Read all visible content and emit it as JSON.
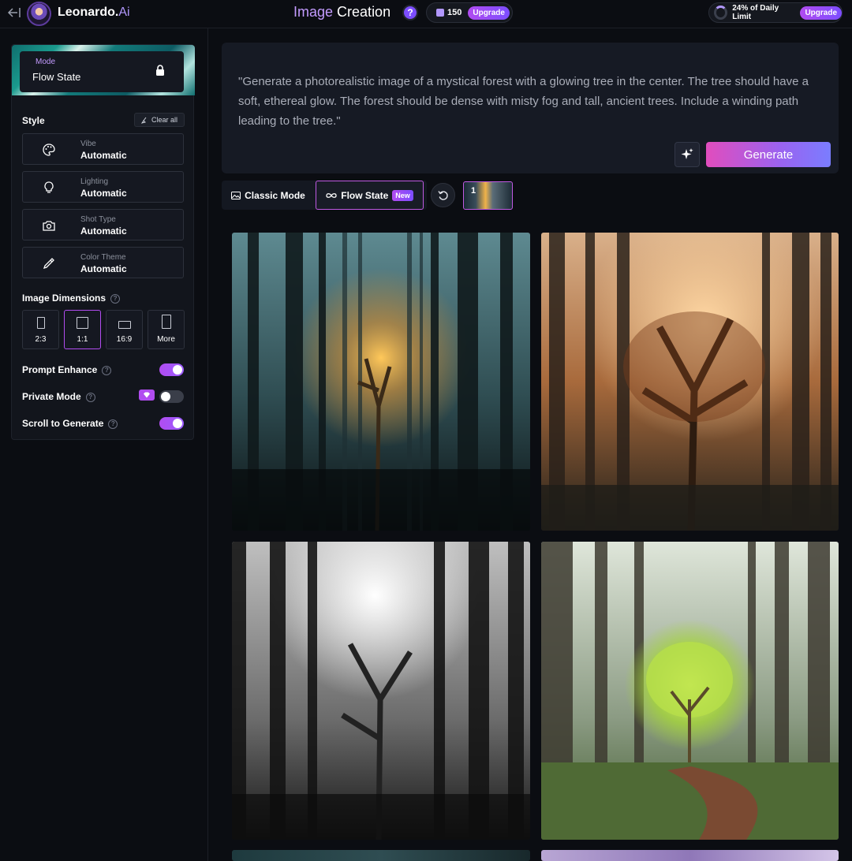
{
  "header": {
    "brand_name": "Leonardo.",
    "brand_suffix": "Ai",
    "title_word1": "Image",
    "title_word2": "Creation",
    "help": "?",
    "tokens": "150",
    "upgrade_label": "Upgrade",
    "daily_limit_text": "24% of Daily Limit",
    "daily_limit_fraction": 0.24,
    "limit_upgrade_label": "Upgrade"
  },
  "sidebar": {
    "mode_label": "Mode",
    "mode_value": "Flow State",
    "style_heading": "Style",
    "clear_all": "Clear all",
    "style_options": [
      {
        "label": "Vibe",
        "value": "Automatic",
        "icon": "palette-icon"
      },
      {
        "label": "Lighting",
        "value": "Automatic",
        "icon": "lightbulb-icon"
      },
      {
        "label": "Shot Type",
        "value": "Automatic",
        "icon": "camera-icon"
      },
      {
        "label": "Color Theme",
        "value": "Automatic",
        "icon": "eyedropper-icon"
      }
    ],
    "dimensions_heading": "Image Dimensions",
    "dimensions": [
      {
        "label": "2:3",
        "active": false
      },
      {
        "label": "1:1",
        "active": true
      },
      {
        "label": "16:9",
        "active": false
      },
      {
        "label": "More",
        "active": false
      }
    ],
    "toggles": {
      "prompt_enhance": {
        "label": "Prompt Enhance",
        "on": true
      },
      "private_mode": {
        "label": "Private Mode",
        "on": false
      },
      "scroll_to_generate": {
        "label": "Scroll to Generate",
        "on": true
      }
    }
  },
  "prompt": {
    "text": "\"Generate a photorealistic image of a mystical forest with a glowing tree in the center. The tree should have a soft, ethereal glow. The forest should be dense with misty fog and tall, ancient trees. Include a winding path leading to the tree.\"",
    "generate_label": "Generate"
  },
  "modes": {
    "classic_label": "Classic Mode",
    "flow_label": "Flow State",
    "new_badge": "New",
    "batch_count": "1"
  },
  "colors": {
    "accent": "#b14cf0",
    "accent2": "#7c4dff",
    "background": "#0b0d12",
    "panel": "#12151c"
  }
}
